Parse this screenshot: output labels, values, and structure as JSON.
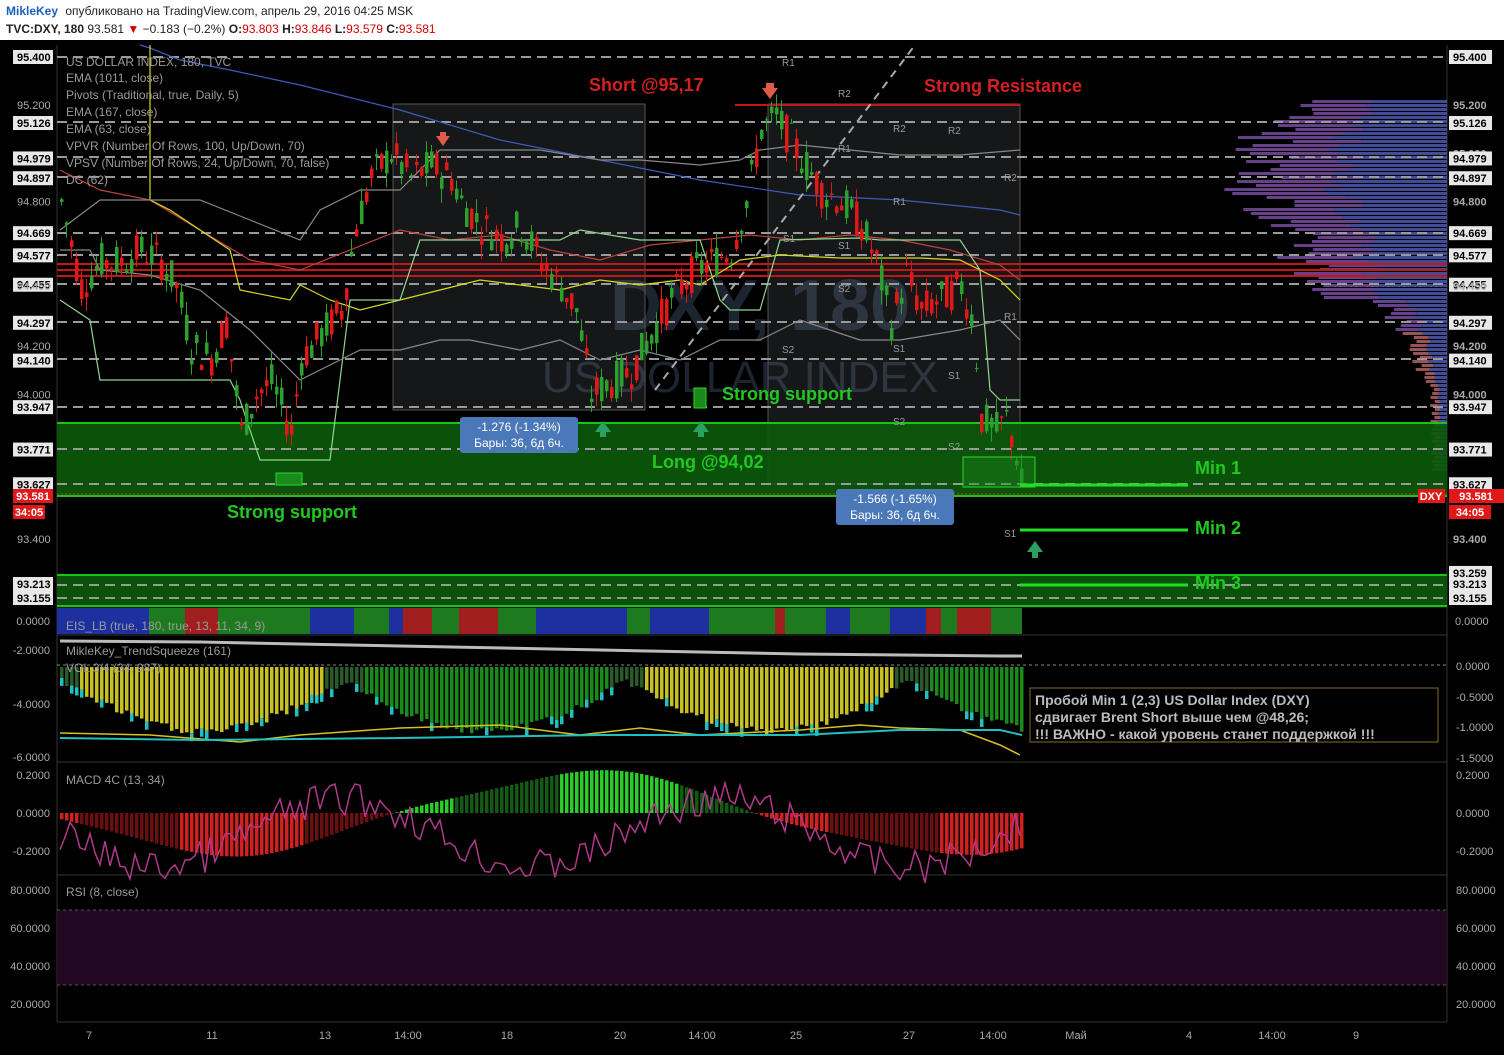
{
  "header": {
    "user": "MikleKey",
    "published": "опубликовано на TradingView.com, апрель 29, 2016 04:25 MSK",
    "symbol": "TVC:DXY, 180",
    "last": "93.581",
    "change": "−0.183 (−0.2%)",
    "o_label": "O:",
    "o": "93.803",
    "h_label": "H:",
    "h": "93.846",
    "l_label": "L:",
    "l": "93.579",
    "c_label": "C:",
    "c": "93.581"
  },
  "legend": [
    "US DOLLAR INDEX, 180, TVC",
    "EMA (1011, close)",
    "Pivots (Traditional, true, Daily, 5)",
    "EMA (167, close)",
    "EMA (63, close)",
    "VPVR (Number Of Rows, 100, Up/Down, 70)",
    "VPSV (Number Of Rows, 24, Up/Down, 70, false)",
    "DC (62)"
  ],
  "watermark": {
    "line1": "DXY, 180",
    "line2": "US DOLLAR INDEX"
  },
  "annotations": {
    "short": "Short @95,17",
    "resistance": "Strong Resistance",
    "strong_support_mid": "Strong support",
    "strong_support_left": "Strong support",
    "long": "Long @94,02",
    "min1": "Min 1",
    "min2": "Min 2",
    "min3": "Min 3"
  },
  "measure_boxes": [
    {
      "line1": "-1.276 (-1.34%)",
      "line2": "Бары: 36, 6д 6ч."
    },
    {
      "line1": "-1.566 (-1.65%)",
      "line2": "Бары: 36, 6д 6ч."
    }
  ],
  "pivots": [
    "R1",
    "R2",
    "R2",
    "R2",
    "R1",
    "R1",
    "S1",
    "S1",
    "S2",
    "S2",
    "S1",
    "S1",
    "S2",
    "S2",
    "S1",
    "R1",
    "R2"
  ],
  "price_axis_right": [
    "95.400",
    "95.200",
    "95.126",
    "95.000",
    "94.979",
    "94.897",
    "94.800",
    "94.669",
    "94.577",
    "94.455",
    "94.450",
    "94.297",
    "94.200",
    "94.140",
    "94.000",
    "93.947",
    "93.771",
    "93.627",
    "93.581",
    "93.400",
    "93.259",
    "93.213",
    "93.155"
  ],
  "price_axis_left": [
    "95.400",
    "95.126",
    "94.979",
    "94.897",
    "94.669",
    "94.577",
    "94.455",
    "94.297",
    "94.140",
    "93.947",
    "93.771",
    "93.627",
    "93.581",
    "93.213",
    "93.155"
  ],
  "price_axis_left_plain": [
    "95.200",
    "94.800",
    "94.450",
    "94.200",
    "94.000",
    "93.400"
  ],
  "dxy_tag": "DXY",
  "countdown": "34:05",
  "panes": {
    "eis": {
      "name": "EIS_LB (true, 180, true, 13, 11, 34, 9)",
      "left_tick": "0.0000",
      "right_tick": "0.0000"
    },
    "squeeze": {
      "name": "MikleKey_TrendSqueeze (161)",
      "name2": "VOL 3/4 (34, 987)",
      "left_ticks": [
        "-2.0000",
        "-4.0000",
        "-6.0000"
      ],
      "right_ticks": [
        "0.0000",
        "-0.5000",
        "-1.0000",
        "-1.5000"
      ]
    },
    "macd": {
      "name": "MACD 4C (13, 34)",
      "ticks": [
        "0.2000",
        "0.0000",
        "-0.2000"
      ]
    },
    "rsi": {
      "name": "RSI (8, close)",
      "ticks": [
        "80.0000",
        "60.0000",
        "40.0000",
        "20.0000"
      ]
    }
  },
  "note": [
    "Пробой Min 1 (2,3) US Dollar Index (DXY)",
    "сдвигает Brent Short выше чем @48,26;",
    "!!! ВАЖНО - какой уровень станет поддержкой !!!"
  ],
  "time_axis": [
    "7",
    "11",
    "13",
    "14:00",
    "18",
    "20",
    "14:00",
    "25",
    "27",
    "14:00",
    "Май",
    "4",
    "14:00",
    "9"
  ],
  "colors": {
    "background": "#000000",
    "bull": "#2ca02c",
    "bear": "#e01818",
    "accent_green": "#22c822",
    "accent_red": "#cc1111",
    "label_blue": "#4a78b8"
  }
}
